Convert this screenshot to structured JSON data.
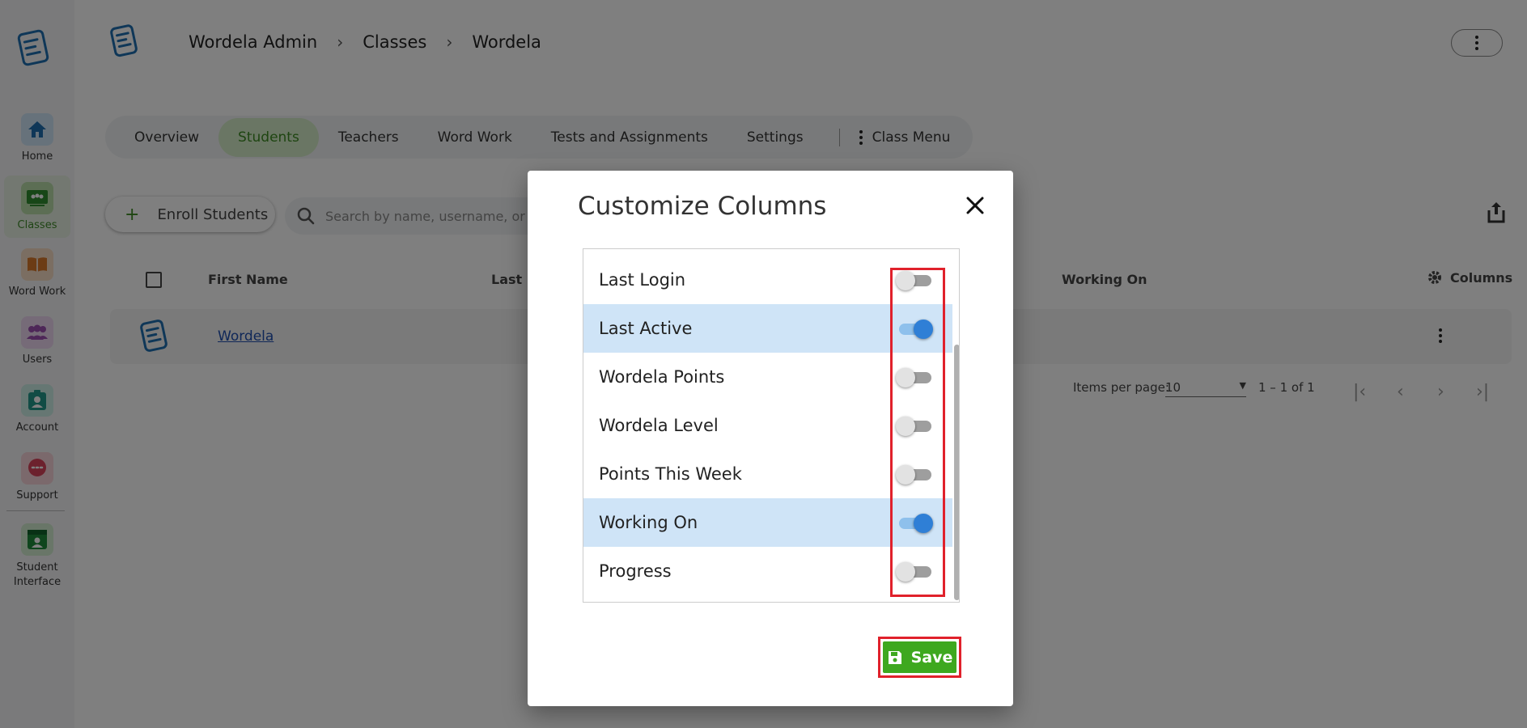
{
  "sidebar": {
    "items": [
      {
        "label": "Home"
      },
      {
        "label": "Classes"
      },
      {
        "label": "Word Work"
      },
      {
        "label": "Users"
      },
      {
        "label": "Account"
      },
      {
        "label": "Support"
      },
      {
        "label": "Student Interface"
      }
    ]
  },
  "breadcrumb": [
    "Wordela Admin",
    "Classes",
    "Wordela"
  ],
  "tabs": [
    "Overview",
    "Students",
    "Teachers",
    "Word Work",
    "Tests and Assignments",
    "Settings",
    "Class Menu"
  ],
  "toolbar": {
    "enroll_label": "Enroll Students",
    "search_placeholder": "Search by name, username, or email"
  },
  "table": {
    "headers": [
      "First Name",
      "Last N",
      "Working On",
      "Columns"
    ],
    "rows": [
      {
        "first_name": "Wordela"
      }
    ]
  },
  "pagination": {
    "items_label": "Items per page:",
    "per_page": "10",
    "range": "1 – 1 of 1"
  },
  "dialog": {
    "title": "Customize Columns",
    "save_label": "Save",
    "options": [
      {
        "label": "Last Login",
        "enabled": false
      },
      {
        "label": "Last Active",
        "enabled": true
      },
      {
        "label": "Wordela Points",
        "enabled": false
      },
      {
        "label": "Wordela Level",
        "enabled": false
      },
      {
        "label": "Points This Week",
        "enabled": false
      },
      {
        "label": "Working On",
        "enabled": true
      },
      {
        "label": "Progress",
        "enabled": false
      }
    ]
  },
  "colors": {
    "accent_green": "#3ea81f",
    "toggle_on": "#2f7fd6",
    "highlight_row": "#cfe4f7",
    "annotation_red": "#e0212b"
  }
}
